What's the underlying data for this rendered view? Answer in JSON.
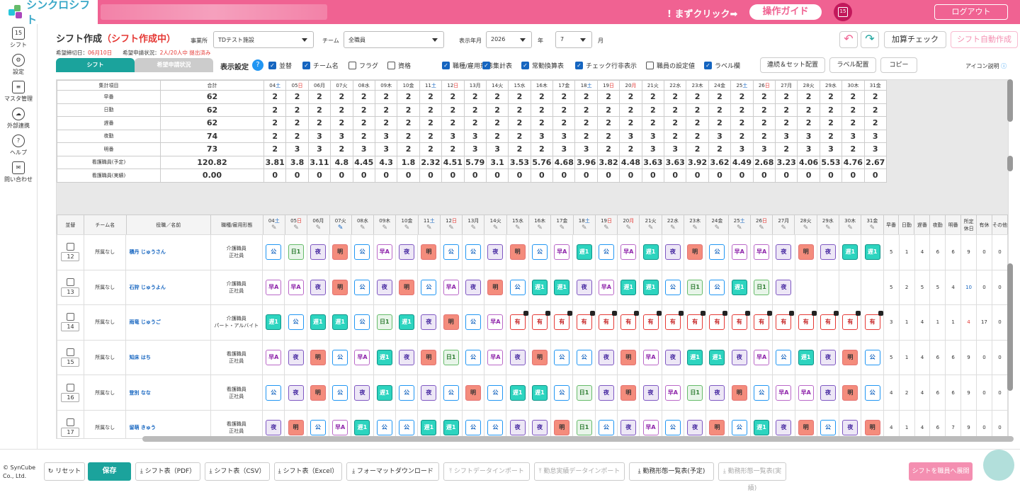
{
  "header": {
    "logo_text": "シンクロシフト",
    "first_click": "! まずクリック➡",
    "guide_button": "操作ガイド",
    "calendar_day": "15",
    "logout": "ログアウト"
  },
  "sidebar": [
    {
      "label": "シフト",
      "icon": "calendar-icon",
      "glyph": "15"
    },
    {
      "label": "設定",
      "icon": "gear-icon",
      "glyph": "⚙"
    },
    {
      "label": "マスタ管理",
      "icon": "database-icon",
      "glyph": "≡"
    },
    {
      "label": "外部連携",
      "icon": "cloud-icon",
      "glyph": "☁"
    },
    {
      "label": "ヘルプ",
      "icon": "help-icon",
      "glyph": "?"
    },
    {
      "label": "問い合わせ",
      "icon": "mail-icon",
      "glyph": "✉"
    }
  ],
  "toolbar": {
    "title": "シフト作成",
    "title_status": "（シフト作成中）",
    "office_label": "事業所",
    "office_value": "TDテスト施設",
    "team_label": "チーム",
    "team_value": "全職員",
    "month_label": "表示年月",
    "year_value": "2026",
    "year_unit": "年",
    "month_value": "7",
    "month_unit": "月",
    "deadline_label": "希望締切日：",
    "deadline_value": "06月10日",
    "request_status_label": "希望申請状況：",
    "request_status_value": "2人/20人中 提出済み",
    "add_check": "加算チェック",
    "auto_create": "シフト自動作成"
  },
  "tabs": {
    "shift": "シフト",
    "request": "希望申請状況"
  },
  "display": {
    "label": "表示設定",
    "help": "?",
    "options": [
      {
        "label": "並替",
        "on": true
      },
      {
        "label": "チーム名",
        "on": true
      },
      {
        "label": "フラグ",
        "on": false
      },
      {
        "label": "資格",
        "on": false
      },
      {
        "label": "職種/雇用形態",
        "on": true
      },
      {
        "label": "集計表",
        "on": true
      },
      {
        "label": "常勤換算表",
        "on": true
      },
      {
        "label": "チェック行非表示",
        "on": true
      },
      {
        "label": "職員の設定値",
        "on": false
      },
      {
        "label": "ラベル欄",
        "on": true
      }
    ],
    "continuous": "連続＆セット配置",
    "label_place": "ラベル配置",
    "copy": "コピー",
    "icon_help": "アイコン説明"
  },
  "days": [
    {
      "d": "04",
      "w": "土",
      "t": "sat"
    },
    {
      "d": "05",
      "w": "日",
      "t": "sun"
    },
    {
      "d": "06",
      "w": "月",
      "t": ""
    },
    {
      "d": "07",
      "w": "火",
      "t": ""
    },
    {
      "d": "08",
      "w": "水",
      "t": ""
    },
    {
      "d": "09",
      "w": "木",
      "t": ""
    },
    {
      "d": "10",
      "w": "金",
      "t": ""
    },
    {
      "d": "11",
      "w": "土",
      "t": "sat"
    },
    {
      "d": "12",
      "w": "日",
      "t": "sun"
    },
    {
      "d": "13",
      "w": "月",
      "t": ""
    },
    {
      "d": "14",
      "w": "火",
      "t": ""
    },
    {
      "d": "15",
      "w": "水",
      "t": ""
    },
    {
      "d": "16",
      "w": "木",
      "t": ""
    },
    {
      "d": "17",
      "w": "金",
      "t": ""
    },
    {
      "d": "18",
      "w": "土",
      "t": "sat"
    },
    {
      "d": "19",
      "w": "日",
      "t": "sun"
    },
    {
      "d": "20",
      "w": "月",
      "t": "sun"
    },
    {
      "d": "21",
      "w": "火",
      "t": ""
    },
    {
      "d": "22",
      "w": "水",
      "t": ""
    },
    {
      "d": "23",
      "w": "木",
      "t": ""
    },
    {
      "d": "24",
      "w": "金",
      "t": ""
    },
    {
      "d": "25",
      "w": "土",
      "t": "sat"
    },
    {
      "d": "26",
      "w": "日",
      "t": "sun"
    },
    {
      "d": "27",
      "w": "月",
      "t": ""
    },
    {
      "d": "28",
      "w": "火",
      "t": ""
    },
    {
      "d": "29",
      "w": "水",
      "t": ""
    },
    {
      "d": "30",
      "w": "木",
      "t": ""
    },
    {
      "d": "31",
      "w": "金",
      "t": ""
    }
  ],
  "summary": {
    "header_item": "集計項目",
    "header_total": "合計",
    "rows": [
      {
        "label": "早番",
        "total": "62",
        "vals": [
          "2",
          "2",
          "2",
          "2",
          "2",
          "2",
          "2",
          "2",
          "2",
          "2",
          "2",
          "2",
          "2",
          "2",
          "2",
          "2",
          "2",
          "2",
          "2",
          "2",
          "2",
          "2",
          "2",
          "2",
          "2",
          "2",
          "2",
          "2"
        ]
      },
      {
        "label": "日勤",
        "total": "62",
        "vals": [
          "2",
          "2",
          "2",
          "2",
          "2",
          "2",
          "2",
          "2",
          "2",
          "2",
          "2",
          "2",
          "2",
          "2",
          "2",
          "2",
          "2",
          "2",
          "2",
          "2",
          "2",
          "2",
          "2",
          "2",
          "2",
          "2",
          "2",
          "2"
        ]
      },
      {
        "label": "遅番",
        "total": "62",
        "vals": [
          "2",
          "2",
          "2",
          "2",
          "2",
          "2",
          "2",
          "2",
          "2",
          "2",
          "2",
          "2",
          "2",
          "2",
          "2",
          "2",
          "2",
          "2",
          "2",
          "2",
          "2",
          "2",
          "2",
          "2",
          "2",
          "2",
          "2",
          "2"
        ]
      },
      {
        "label": "夜勤",
        "total": "74",
        "vals": [
          "2",
          "2",
          "3",
          "3",
          "2",
          "3",
          "2",
          "2",
          "3",
          "3",
          "2",
          "2",
          "3",
          "3",
          "2",
          "2",
          "3",
          "3",
          "2",
          "2",
          "3",
          "2",
          "2",
          "3",
          "3",
          "2",
          "3",
          "3"
        ]
      },
      {
        "label": "明番",
        "total": "73",
        "vals": [
          "2",
          "3",
          "3",
          "2",
          "3",
          "3",
          "2",
          "2",
          "2",
          "3",
          "3",
          "2",
          "2",
          "3",
          "3",
          "2",
          "2",
          "3",
          "3",
          "2",
          "2",
          "3",
          "3",
          "2",
          "3",
          "3",
          "2",
          "3"
        ]
      },
      {
        "label": "看護職員(予定)",
        "total": "120.82",
        "vals": [
          "3.81",
          "3.8",
          "3.11",
          "4.8",
          "4.45",
          "4.3",
          "1.8",
          "2.32",
          "4.51",
          "5.79",
          "3.1",
          "3.53",
          "5.76",
          "4.68",
          "3.96",
          "3.82",
          "4.48",
          "3.63",
          "3.63",
          "3.92",
          "3.62",
          "4.49",
          "2.68",
          "3.23",
          "4.06",
          "5.53",
          "4.76",
          "2.67"
        ]
      },
      {
        "label": "看護職員(実績)",
        "total": "0.00",
        "vals": [
          "0",
          "0",
          "0",
          "0",
          "0",
          "0",
          "0",
          "0",
          "0",
          "0",
          "0",
          "0",
          "0",
          "0",
          "0",
          "0",
          "0",
          "0",
          "0",
          "0",
          "0",
          "0",
          "0",
          "0",
          "0",
          "0",
          "0",
          "0"
        ]
      }
    ]
  },
  "staff_head": {
    "sort": "並替",
    "team": "チーム名",
    "name": "役職／名前",
    "job": "職種/雇用形態",
    "counts": [
      "早番",
      "日勤",
      "遅番",
      "夜勤",
      "明番",
      "所定休日",
      "有休",
      "その他"
    ]
  },
  "staff": [
    {
      "num": "12",
      "team": "所属なし",
      "name": "積丹 じゅうさん",
      "job": "介護職員",
      "emp": "正社員",
      "shifts": [
        "公",
        "日1",
        "夜",
        "明",
        "公",
        "早A",
        "夜",
        "明",
        "公",
        "公",
        "夜",
        "明",
        "公",
        "早A",
        "遅1",
        "公",
        "早A",
        "遅1",
        "夜",
        "明",
        "公",
        "早A",
        "早A",
        "夜",
        "明",
        "夜",
        "遅1",
        "遅1"
      ],
      "counts": [
        "5",
        "1",
        "4",
        "6",
        "6",
        "9",
        "0",
        "0"
      ],
      "red": -1
    },
    {
      "num": "13",
      "team": "所属なし",
      "name": "石狩 じゅうよん",
      "job": "介護職員",
      "emp": "正社員",
      "shifts": [
        "早A",
        "早A",
        "夜",
        "明",
        "公",
        "夜",
        "明",
        "公",
        "早A",
        "夜",
        "明",
        "公",
        "遅1",
        "遅1",
        "夜",
        "早A",
        "遅1",
        "遅1",
        "公",
        "日1",
        "公",
        "遅1",
        "日1",
        "夜",
        "",
        "",
        "",
        "",
        ""
      ],
      "counts": [
        "5",
        "2",
        "5",
        "5",
        "4",
        "10",
        "0",
        "0"
      ],
      "red": -1
    },
    {
      "num": "14",
      "team": "所属なし",
      "name": "雨竜 じゅうご",
      "job": "介護職員",
      "emp": "パート・アルバイト",
      "shifts": [
        "遅1",
        "公",
        "遅1",
        "遅1",
        "公",
        "日1",
        "遅1",
        "夜",
        "明",
        "公",
        "早A",
        "有",
        "有",
        "有",
        "有",
        "有",
        "有",
        "有",
        "有",
        "有",
        "有",
        "有",
        "有",
        "有",
        "有",
        "有",
        "有",
        "有"
      ],
      "counts": [
        "3",
        "1",
        "4",
        "1",
        "1",
        "4",
        "17",
        "0"
      ],
      "red": 5
    },
    {
      "num": "15",
      "team": "所属なし",
      "name": "知床 はち",
      "job": "看護職員",
      "emp": "正社員",
      "shifts": [
        "早A",
        "夜",
        "明",
        "公",
        "早A",
        "遅1",
        "夜",
        "明",
        "日1",
        "公",
        "早A",
        "夜",
        "明",
        "公",
        "公",
        "夜",
        "明",
        "早A",
        "夜",
        "遅1",
        "遅1",
        "夜",
        "早A",
        "公",
        "遅1",
        "夜",
        "明",
        "公"
      ],
      "counts": [
        "5",
        "1",
        "4",
        "6",
        "6",
        "9",
        "0",
        "0"
      ],
      "red": -1
    },
    {
      "num": "16",
      "team": "所属なし",
      "name": "登別 なな",
      "job": "看護職員",
      "emp": "正社員",
      "shifts": [
        "公",
        "夜",
        "明",
        "公",
        "夜",
        "遅1",
        "公",
        "夜",
        "公",
        "明",
        "公",
        "遅1",
        "遅1",
        "公",
        "日1",
        "夜",
        "明",
        "夜",
        "早A",
        "日1",
        "夜",
        "明",
        "公",
        "早A",
        "早A",
        "夜",
        "明",
        "公"
      ],
      "counts": [
        "4",
        "2",
        "4",
        "6",
        "6",
        "9",
        "0",
        "0"
      ],
      "red": -1
    },
    {
      "num": "17",
      "team": "所属なし",
      "name": "留萌 きゅう",
      "job": "看護職員",
      "emp": "正社員",
      "shifts": [
        "夜",
        "明",
        "公",
        "早A",
        "遅1",
        "公",
        "公",
        "遅1",
        "遅1",
        "公",
        "公",
        "夜",
        "夜",
        "明",
        "日1",
        "公",
        "夜",
        "早A",
        "公",
        "夜",
        "明",
        "公",
        "遅1",
        "夜",
        "明",
        "公",
        "夜",
        "明"
      ],
      "counts": [
        "4",
        "1",
        "4",
        "6",
        "7",
        "9",
        "0",
        "0"
      ],
      "red": -1
    }
  ],
  "footer": {
    "copyright": "© SynCube Co., Ltd.",
    "reset": "↻ リセット",
    "save": "保存",
    "pdf": "⤓ シフト表（PDF）",
    "csv": "⤓ シフト表（CSV）",
    "excel": "⤓ シフト表（Excel）",
    "format": "⤓ フォーマットダウンロード",
    "import_shift": "⤒ シフトデータインポート",
    "import_actual": "⤒ 勤怠実績データインポート",
    "work_plan": "⤓ 勤務形態一覧表(予定)",
    "work_actual": "⤓ 勤務形態一覧表(実績)",
    "publish": "シフトを職員へ展開"
  }
}
